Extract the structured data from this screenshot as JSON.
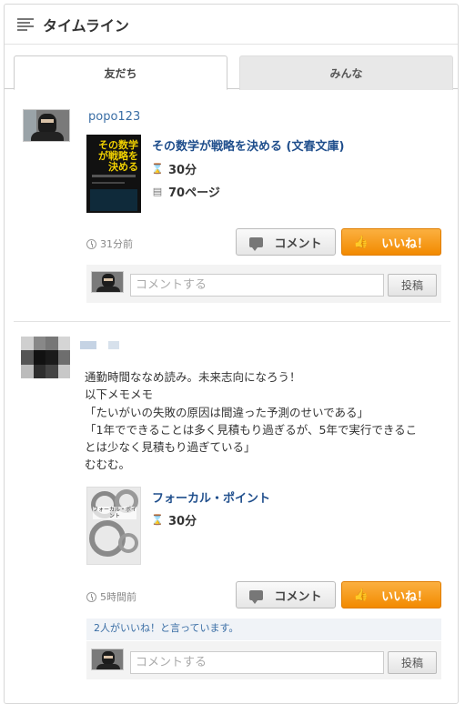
{
  "header": {
    "title": "タイムライン",
    "icon": "menu-lines-icon"
  },
  "tabs": [
    {
      "label": "友だち",
      "active": true
    },
    {
      "label": "みんな",
      "active": false
    }
  ],
  "posts": [
    {
      "username": "popo123",
      "book": {
        "cover_text": "その数学が戦略を決める",
        "title": "その数学が戦略を決める (文春文庫)",
        "time": "30分",
        "pages": "70ページ"
      },
      "timestamp": "31分前",
      "comment_label": "コメント",
      "like_label": "いいね！",
      "comment_placeholder": "コメントする",
      "post_label": "投稿"
    },
    {
      "username": "",
      "text_lines": [
        "通勤時間ななめ読み。未来志向になろう！",
        "以下メモメモ",
        "「たいがいの失敗の原因は間違った予測のせいである」",
        "「1年でできることは多く見積もり過ぎるが、5年で実行できるこ",
        "とは少なく見積もり過ぎている」",
        "むむむ。"
      ],
      "book": {
        "cover_text": "フォーカル・ポイント",
        "title": "フォーカル・ポイント",
        "time": "30分"
      },
      "timestamp": "5時間前",
      "comment_label": "コメント",
      "like_label": "いいね！",
      "likes_text": "2人がいいね！と言っています。",
      "comment_placeholder": "コメントする",
      "post_label": "投稿"
    }
  ],
  "colors": {
    "accent_orange": "#f5a21c",
    "link_blue": "#1f4e8c"
  }
}
